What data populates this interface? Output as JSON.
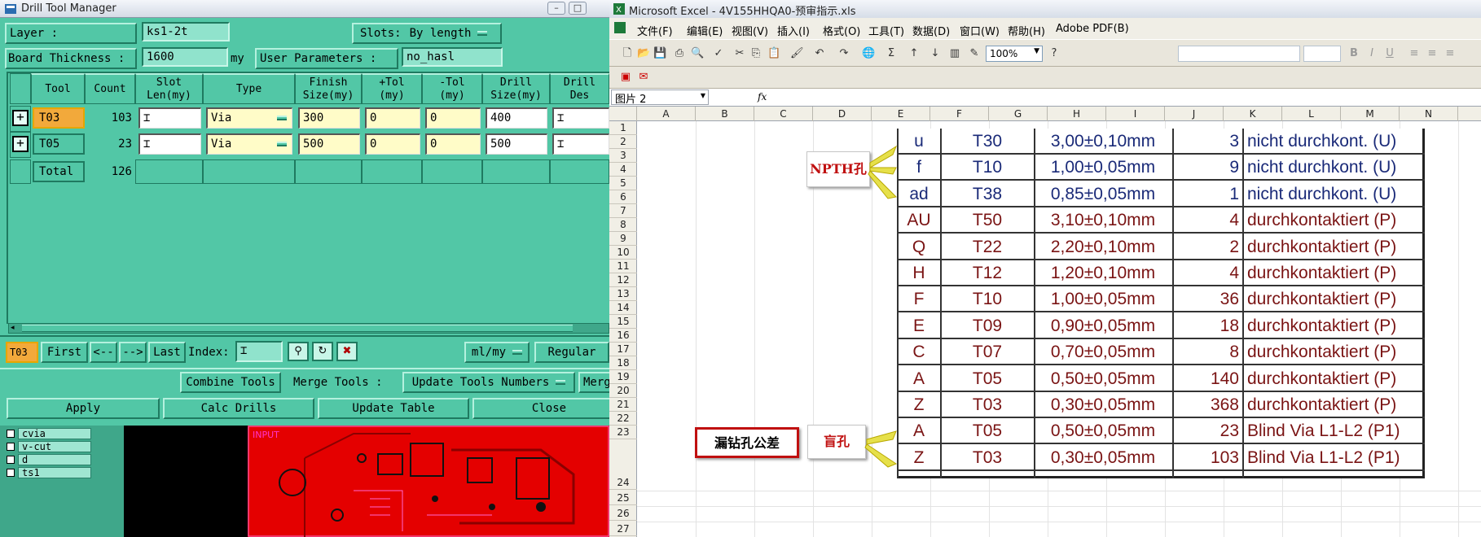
{
  "drill_manager": {
    "title": "Drill Tool Manager",
    "layer_label": "Layer            :",
    "layer_value": "ks1-2t",
    "slots_label": "Slots:",
    "slots_value": "By length",
    "board_thickness_label": "Board Thickness :",
    "board_thickness_value": "1600",
    "board_thickness_unit": "my",
    "user_params_label": "User Parameters :",
    "user_params_value": "no_hasl",
    "columns": [
      "Tool",
      "Count",
      "Slot\nLen(my)",
      "Type",
      "Finish\nSize(my)",
      "+Tol\n(my)",
      "-Tol\n(my)",
      "Drill\nSize(my)",
      "Drill\nDes"
    ],
    "rows": [
      {
        "tool": "T03",
        "count": "103",
        "type": "Via",
        "finish": "300",
        "ptol": "0",
        "ntol": "0",
        "drill": "400"
      },
      {
        "tool": "T05",
        "count": "23",
        "type": "Via",
        "finish": "500",
        "ptol": "0",
        "ntol": "0",
        "drill": "500"
      }
    ],
    "total_label": "Total",
    "total_count": "126",
    "current_tool": "T03",
    "nav": {
      "first": "First",
      "prev": "<--",
      "next": "-->",
      "last": "Last",
      "index_label": "Index:",
      "units": "ml/my",
      "mode": "Regular"
    },
    "buttons": {
      "combine": "Combine Tools",
      "merge_label": "Merge Tools :",
      "update_numbers": "Update Tools Numbers",
      "merge_short": "Merg",
      "apply": "Apply",
      "calc": "Calc Drills",
      "update_table": "Update Table",
      "close": "Close"
    },
    "layers": [
      "cvia",
      "v-cut",
      "d",
      "ts1"
    ],
    "pcb_text": "INPUT"
  },
  "excel": {
    "title": "Microsoft Excel - 4V155HHQA0-预审指示.xls",
    "menu": [
      "文件(F)",
      "编辑(E)",
      "视图(V)",
      "插入(I)",
      "格式(O)",
      "工具(T)",
      "数据(D)",
      "窗口(W)",
      "帮助(H)",
      "Adobe PDF(B)"
    ],
    "zoom": "100%",
    "name_box": "图片 2",
    "fx": "fx",
    "columns": [
      "A",
      "B",
      "C",
      "D",
      "E",
      "F",
      "G",
      "H",
      "I",
      "J",
      "K",
      "L",
      "M",
      "N"
    ],
    "rows": [
      "1",
      "2",
      "3",
      "4",
      "5",
      "6",
      "7",
      "8",
      "9",
      "10",
      "11",
      "12",
      "13",
      "14",
      "15",
      "16",
      "17",
      "18",
      "19",
      "20",
      "21",
      "22",
      "23",
      "24",
      "25",
      "26",
      "27"
    ],
    "table": [
      {
        "code": "u",
        "tool": "T30",
        "size": "3,00±0,10mm",
        "qty": "3",
        "desc": "nicht durchkont. (U)",
        "color": "#1a2a78"
      },
      {
        "code": "f",
        "tool": "T10",
        "size": "1,00±0,05mm",
        "qty": "9",
        "desc": "nicht durchkont. (U)",
        "color": "#1a2a78"
      },
      {
        "code": "ad",
        "tool": "T38",
        "size": "0,85±0,05mm",
        "qty": "1",
        "desc": "nicht durchkont. (U)",
        "color": "#1a2a78"
      },
      {
        "code": "AU",
        "tool": "T50",
        "size": "3,10±0,10mm",
        "qty": "4",
        "desc": "durchkontaktiert (P)",
        "color": "#7a1414"
      },
      {
        "code": "Q",
        "tool": "T22",
        "size": "2,20±0,10mm",
        "qty": "2",
        "desc": "durchkontaktiert (P)",
        "color": "#7a1414"
      },
      {
        "code": "H",
        "tool": "T12",
        "size": "1,20±0,10mm",
        "qty": "4",
        "desc": "durchkontaktiert (P)",
        "color": "#7a1414"
      },
      {
        "code": "F",
        "tool": "T10",
        "size": "1,00±0,05mm",
        "qty": "36",
        "desc": "durchkontaktiert (P)",
        "color": "#7a1414"
      },
      {
        "code": "E",
        "tool": "T09",
        "size": "0,90±0,05mm",
        "qty": "18",
        "desc": "durchkontaktiert (P)",
        "color": "#7a1414"
      },
      {
        "code": "C",
        "tool": "T07",
        "size": "0,70±0,05mm",
        "qty": "8",
        "desc": "durchkontaktiert (P)",
        "color": "#7a1414"
      },
      {
        "code": "A",
        "tool": "T05",
        "size": "0,50±0,05mm",
        "qty": "140",
        "desc": "durchkontaktiert (P)",
        "color": "#7a1414"
      },
      {
        "code": "Z",
        "tool": "T03",
        "size": "0,30±0,05mm",
        "qty": "368",
        "desc": "durchkontaktiert (P)",
        "color": "#7a1414"
      },
      {
        "code": "A",
        "tool": "T05",
        "size": "0,50±0,05mm",
        "qty": "23",
        "desc": "Blind Via L1-L2 (P1)",
        "color": "#7a1414"
      },
      {
        "code": "Z",
        "tool": "T03",
        "size": "0,30±0,05mm",
        "qty": "103",
        "desc": "Blind Via L1-L2 (P1)",
        "color": "#7a1414"
      }
    ],
    "callouts": {
      "npth": "NPTH孔",
      "blind": "盲孔",
      "missed": "漏钻孔公差"
    }
  }
}
